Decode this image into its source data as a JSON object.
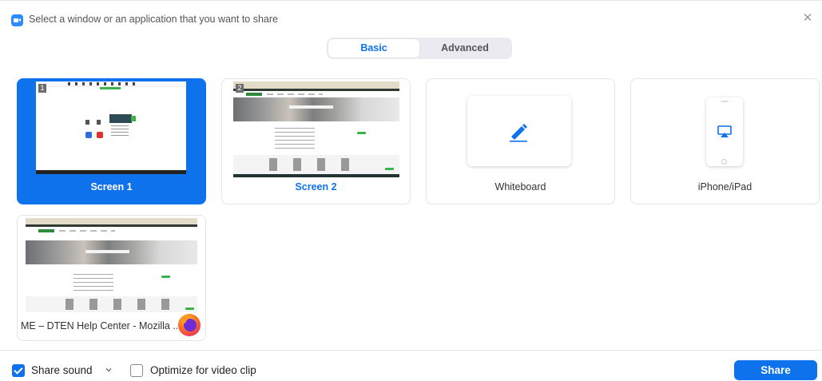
{
  "window": {
    "title": "Select a window or an application that you want to share",
    "close_glyph": "✕",
    "app_icon": "zoom-camera-icon"
  },
  "tabs": [
    {
      "label": "Basic",
      "active": true
    },
    {
      "label": "Advanced",
      "active": false
    }
  ],
  "tiles": [
    {
      "label": "Screen 1",
      "number": "1",
      "selected": true
    },
    {
      "label": "Screen 2",
      "number": "2",
      "selected": false
    },
    {
      "label": "Whiteboard",
      "icon": "pen-icon",
      "selected": false
    },
    {
      "label": "iPhone/iPad",
      "icon": "airplay-icon",
      "selected": false
    },
    {
      "label": "ME – DTEN Help Center - Mozilla ...",
      "icon": "firefox-icon",
      "selected": false
    }
  ],
  "footer": {
    "share_sound": {
      "label": "Share sound",
      "checked": true
    },
    "optimize_video": {
      "label": "Optimize for video clip",
      "checked": false
    },
    "share_button": "Share"
  },
  "colors": {
    "accent": "#0e72ed",
    "selected_tile": "#0e72ed"
  }
}
